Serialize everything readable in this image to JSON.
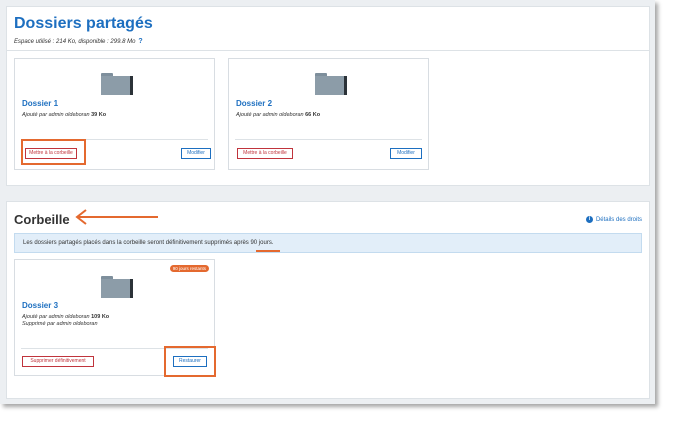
{
  "shared": {
    "title": "Dossiers partagés",
    "usage": "Espace utilisé : 214 Ko, disponible : 299.8 Mo",
    "help": "?",
    "folders": [
      {
        "name": "Dossier 1",
        "added_prefix": "Ajouté par admin oldeboran",
        "size": "39 Ko",
        "trash_label": "Mettre à la corbeille",
        "modify_label": "Modifier"
      },
      {
        "name": "Dossier 2",
        "added_prefix": "Ajouté par admin oldeboran",
        "size": "66 Ko",
        "trash_label": "Mettre à la corbeille",
        "modify_label": "Modifier"
      }
    ]
  },
  "trash": {
    "title": "Corbeille",
    "rights_label": "Détails des droits",
    "info_before": "Les dossiers partagés placés dans la corbeille seront définitivement supprimés après",
    "info_days": "90 jours",
    "info_after": ".",
    "items": [
      {
        "name": "Dossier 3",
        "badge": "90 jours restants",
        "added_prefix": "Ajouté par admin oldeboran",
        "size": "109 Ko",
        "deleted_by": "Supprimé par admin oldeboran",
        "delete_label": "Supprimer définitivement",
        "restore_label": "Restaurer"
      }
    ]
  },
  "colors": {
    "accent_blue": "#1d6fc0",
    "danger_red": "#c0343c",
    "highlight_orange": "#e4692f"
  }
}
